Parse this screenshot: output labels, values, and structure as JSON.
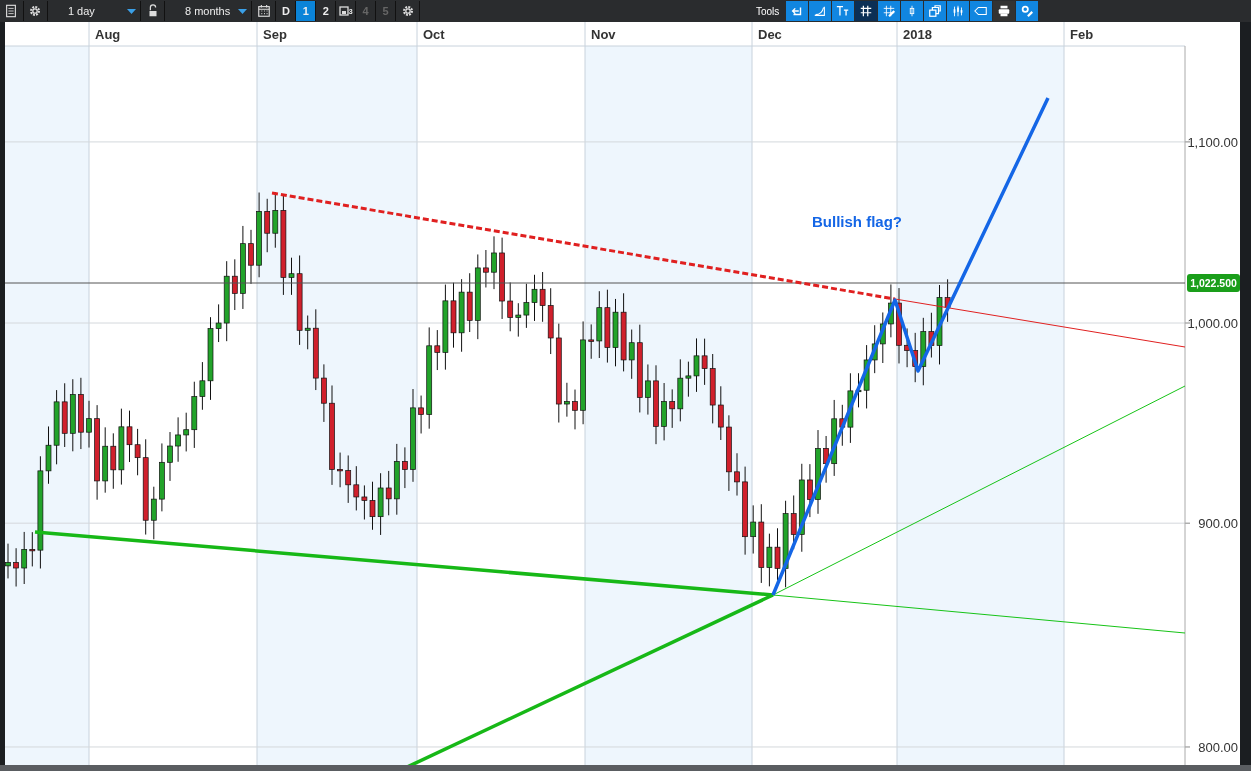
{
  "toolbar": {
    "interval": "1 day",
    "range": "8 months",
    "layout_buttons": [
      {
        "kind": "text",
        "label": "D",
        "selected": false,
        "disabled": false
      },
      {
        "kind": "text",
        "label": "1",
        "selected": true,
        "disabled": false
      },
      {
        "kind": "text",
        "label": "2",
        "selected": false,
        "disabled": false
      },
      {
        "kind": "icon",
        "label": "3",
        "selected": false,
        "disabled": false
      },
      {
        "kind": "text",
        "label": "4",
        "selected": false,
        "disabled": true
      },
      {
        "kind": "text",
        "label": "5",
        "selected": false,
        "disabled": true
      }
    ],
    "tools_label": "Tools",
    "tools": [
      {
        "kind": "back",
        "selected": false
      },
      {
        "kind": "curve",
        "selected": false
      },
      {
        "kind": "text",
        "selected": false
      },
      {
        "kind": "grid",
        "selected": true
      },
      {
        "kind": "grid-pencil",
        "selected": false
      },
      {
        "kind": "candle",
        "selected": false
      },
      {
        "kind": "windows",
        "selected": false
      },
      {
        "kind": "candles",
        "selected": false
      },
      {
        "kind": "tag",
        "selected": false
      },
      {
        "kind": "print",
        "selected": true
      },
      {
        "kind": "settings",
        "selected": false
      }
    ]
  },
  "chart": {
    "months": [
      "Aug",
      "Sep",
      "Oct",
      "Nov",
      "Dec",
      "2018",
      "Feb"
    ],
    "y_labels": [
      "1,100.00",
      "1,000.00",
      "900.00",
      "800.00"
    ],
    "price_badge": "1,022.500",
    "annotation": "Bullish flag?"
  }
}
